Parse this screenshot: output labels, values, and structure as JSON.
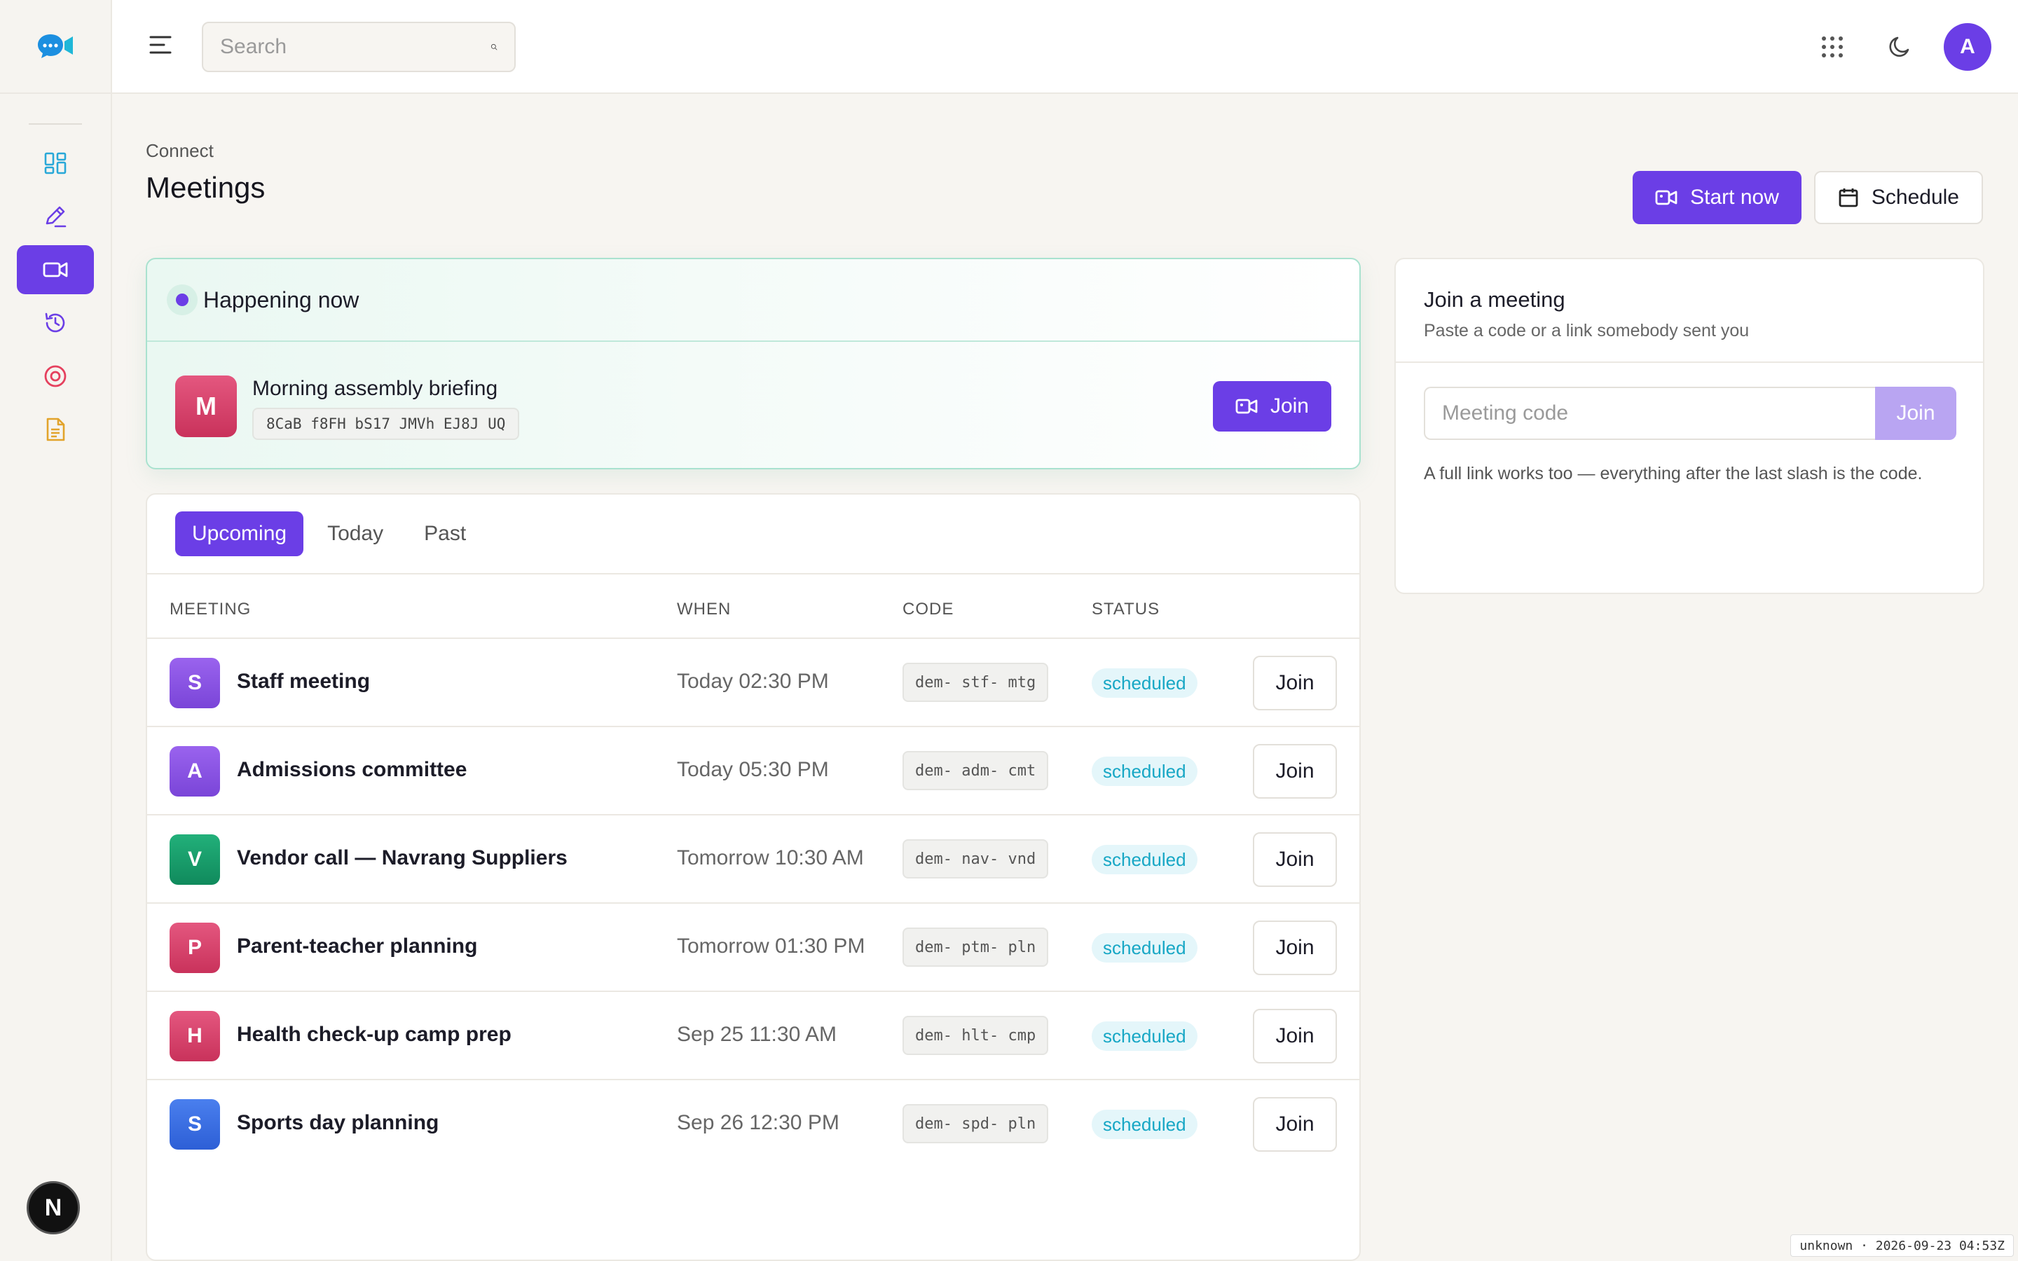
{
  "sidebar": {
    "logo_icon": "chat-video-logo-icon",
    "items": [
      {
        "icon": "dashboard-icon",
        "color": "#29a8d8",
        "active": false
      },
      {
        "icon": "pencil-icon",
        "color": "#6b3ee6",
        "active": false
      },
      {
        "icon": "video-camera-icon",
        "color": "#ffffff",
        "active": true
      },
      {
        "icon": "history-icon",
        "color": "#6b3ee6",
        "active": false
      },
      {
        "icon": "target-icon",
        "color": "#e5405e",
        "active": false
      },
      {
        "icon": "document-icon",
        "color": "#e2a32b",
        "active": false
      }
    ],
    "footer_badge": "N"
  },
  "topbar": {
    "search_placeholder": "Search",
    "avatar_letter": "A"
  },
  "page": {
    "breadcrumb": "Connect",
    "title": "Meetings",
    "start_now_label": "Start now",
    "schedule_label": "Schedule"
  },
  "live": {
    "heading": "Happening now",
    "avatar_letter": "M",
    "name": "Morning assembly briefing",
    "code": "8CaB f8FH bS17 JMVh EJ8J UQ",
    "join_label": "Join"
  },
  "tabs": [
    {
      "label": "Upcoming",
      "active": true
    },
    {
      "label": "Today",
      "active": false
    },
    {
      "label": "Past",
      "active": false
    }
  ],
  "table": {
    "headers": {
      "meeting": "MEETING",
      "when": "WHEN",
      "code": "CODE",
      "status": "STATUS"
    },
    "join_label": "Join",
    "rows": [
      {
        "letter": "S",
        "name": "Staff meeting",
        "when": "Today 02:30 PM",
        "code": "dem- stf- mtg",
        "status": "scheduled",
        "color_top": "#9a63ee",
        "color_bottom": "#7a45d8"
      },
      {
        "letter": "A",
        "name": "Admissions committee",
        "when": "Today 05:30 PM",
        "code": "dem- adm- cmt",
        "status": "scheduled",
        "color_top": "#9a63ee",
        "color_bottom": "#7a45d8"
      },
      {
        "letter": "V",
        "name": "Vendor call — Navrang Suppliers",
        "when": "Tomorrow 10:30 AM",
        "code": "dem- nav- vnd",
        "status": "scheduled",
        "color_top": "#22b07a",
        "color_bottom": "#108a5c"
      },
      {
        "letter": "P",
        "name": "Parent-teacher planning",
        "when": "Tomorrow 01:30 PM",
        "code": "dem- ptm- pln",
        "status": "scheduled",
        "color_top": "#e4577f",
        "color_bottom": "#c9325b"
      },
      {
        "letter": "H",
        "name": "Health check-up camp prep",
        "when": "Sep 25 11:30 AM",
        "code": "dem- hlt- cmp",
        "status": "scheduled",
        "color_top": "#e4577f",
        "color_bottom": "#c9325b"
      },
      {
        "letter": "S",
        "name": "Sports day planning",
        "when": "Sep 26 12:30 PM",
        "code": "dem- spd- pln",
        "status": "scheduled",
        "color_top": "#4a7fee",
        "color_bottom": "#2d5fd6"
      }
    ]
  },
  "join_card": {
    "title": "Join a meeting",
    "subtitle": "Paste a code or a link somebody sent you",
    "input_placeholder": "Meeting code",
    "submit_label": "Join",
    "hint": "A full link works too — everything after the last slash is the code."
  },
  "footer": {
    "stamp": "unknown · 2026-09-23 04:53Z"
  },
  "colors": {
    "accent": "#6b3ee6",
    "status_text": "#17a7c5",
    "status_bg": "#e4f6fa",
    "live_border": "#a9e2cf"
  }
}
